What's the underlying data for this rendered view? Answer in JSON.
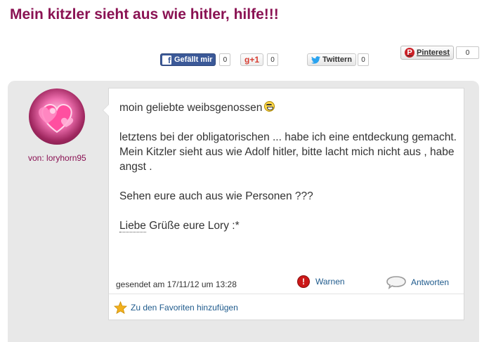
{
  "page": {
    "title": "Mein kitzler sieht aus wie hitler, hilfe!!!"
  },
  "share": {
    "facebook": {
      "logo": "f",
      "label": "Gefällt mir",
      "count": "0"
    },
    "gplus": {
      "label": "g+1",
      "count": "0"
    },
    "twitter": {
      "label": "Twittern",
      "count": "0"
    },
    "pinterest": {
      "logo": "P",
      "label": "Pinterest",
      "count": "0"
    }
  },
  "post": {
    "author_prefix": "von:",
    "author": "loryhorn95",
    "greeting": "moin geliebte weibsgenossen",
    "paragraph1": "letztens bei der obligatorischen ... habe ich eine entdeckung gemacht. Mein Kitzler sieht aus wie Adolf hitler, bitte lacht mich nicht aus , habe angst .",
    "paragraph2": "Sehen eure auch aus wie Personen ???",
    "signature_word": "Liebe",
    "signature_rest": " Grüße eure Lory :*",
    "sent": "gesendet am 17/11/12 um 13:28",
    "warn_label": "Warnen",
    "warn_icon_glyph": "!",
    "reply_label": "Antworten",
    "fav_label": "Zu den Favoriten hinzufügen"
  },
  "icons": {
    "facebook": "facebook-icon",
    "twitter": "twitter-bird-icon",
    "pinterest": "pinterest-icon",
    "emoji": "grinning-smiley-icon",
    "warn": "warning-exclamation-icon",
    "reply": "speech-bubble-icon",
    "favorite": "star-icon",
    "avatar": "pink-hearts-avatar"
  },
  "colors": {
    "title": "#8a1253",
    "link": "#1e5a8c",
    "facebook": "#3b5998",
    "gplus": "#d73d32",
    "pinterest": "#cb2027",
    "card_bg": "#e8e8e8",
    "warn_red": "#cc1818",
    "star": "#f2b01e"
  }
}
